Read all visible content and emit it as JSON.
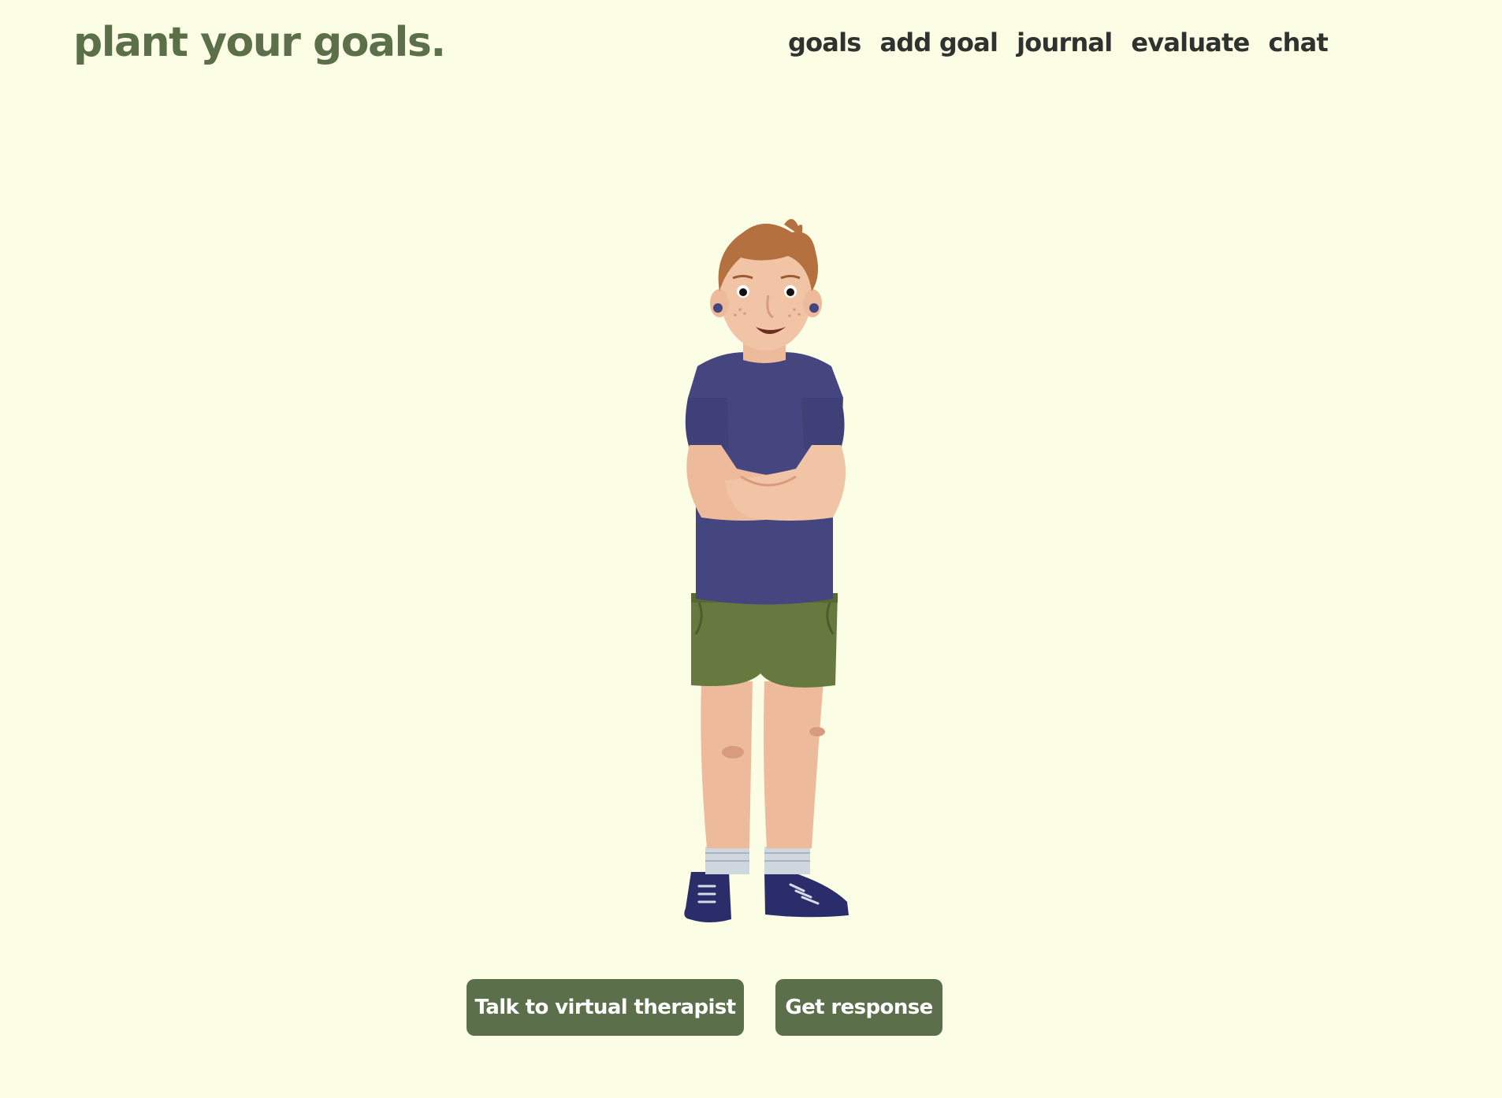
{
  "header": {
    "brand": "plant your goals.",
    "nav": [
      "goals",
      "add goal",
      "journal",
      "evaluate",
      "chat"
    ]
  },
  "avatar": {
    "description_icon": "character-illustration"
  },
  "actions": {
    "talk_label": "Talk to virtual therapist",
    "response_label": "Get response"
  },
  "colors": {
    "background": "#fbfde4",
    "brand": "#5b6f49",
    "nav_text": "#2f3330",
    "button_bg": "#5b6f4a",
    "button_text": "#ffffff"
  }
}
